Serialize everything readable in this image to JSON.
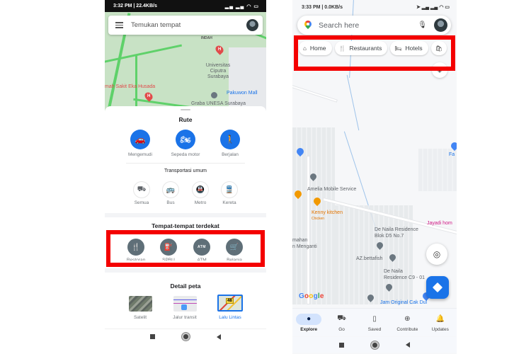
{
  "left_phone": {
    "status_bar": {
      "time": "3:32 PM | 22.4KB/s",
      "indicators": "signal · wifi · battery 30"
    },
    "search": {
      "placeholder": "Temukan tempat",
      "menu_icon": "hamburger-icon",
      "avatar": "profile-avatar"
    },
    "map_labels": {
      "indah": "INDAH",
      "universitas": "Universitas Ciputra Surabaya",
      "rs": "mah Sakit Eka Husada",
      "pakuwon": "Pakuwon Mall",
      "graha": "Graba UNESA Surabaya"
    },
    "route": {
      "title": "Rute",
      "modes": [
        {
          "label": "Mengemudi",
          "icon": "car-icon"
        },
        {
          "label": "Sepeda motor",
          "icon": "motorcycle-icon"
        },
        {
          "label": "Berjalan",
          "icon": "walk-icon"
        }
      ],
      "transit_title": "Transportasi umum",
      "transit_modes": [
        {
          "label": "Semua",
          "icon": "transit-icon"
        },
        {
          "label": "Bus",
          "icon": "bus-icon"
        },
        {
          "label": "Metro",
          "icon": "metro-icon"
        },
        {
          "label": "Kereta",
          "icon": "train-icon"
        }
      ]
    },
    "nearby": {
      "title": "Tempat-tempat terdekat",
      "items": [
        {
          "label": "Restoran",
          "icon": "restaurant-icon",
          "glyph": "🍴"
        },
        {
          "label": "SPBU",
          "icon": "gas-station-icon",
          "glyph": "⛽"
        },
        {
          "label": "ATM",
          "icon": "atm-icon",
          "glyph": "ATM"
        },
        {
          "label": "Belanja",
          "icon": "shopping-cart-icon",
          "glyph": "🛒"
        }
      ]
    },
    "map_details": {
      "title": "Detail peta",
      "layers": [
        {
          "label": "Satelit",
          "selected": false
        },
        {
          "label": "Jalur transit",
          "selected": false
        },
        {
          "label": "Lalu Lintas",
          "selected": true,
          "badge": "48"
        }
      ]
    }
  },
  "right_phone": {
    "status_bar": {
      "time": "3:33 PM | 0.0KB/s",
      "indicators": "location · signal · wifi · battery 30"
    },
    "search": {
      "placeholder": "Search here"
    },
    "chips": [
      {
        "label": "Home",
        "icon": "home-icon",
        "glyph": "⌂"
      },
      {
        "label": "Restaurants",
        "icon": "restaurant-icon",
        "glyph": "🍴"
      },
      {
        "label": "Hotels",
        "icon": "hotel-icon",
        "glyph": "🛏"
      },
      {
        "label": "",
        "icon": "shopping-bag-icon",
        "glyph": "🛍"
      }
    ],
    "map_labels": {
      "amelia": "Amelia Mobile Service",
      "kenny": "Kenny kitchen",
      "kenny_sub": "Chicken",
      "jayadi": "Jayadi hom",
      "denaila1": "De Naila Residence\nBlok D5 No.7",
      "rumahan": "mahan\nn Menganti",
      "azbetta": "AZ.bettafish",
      "denaila2": "De Naila\nResidence C9 - 01",
      "jam": "Jam Original Cak Dul",
      "fa": "Fa",
      "google": "Google"
    },
    "bottom_nav": [
      {
        "label": "Explore",
        "icon": "explore-pin-icon",
        "glyph": "📍",
        "active": true
      },
      {
        "label": "Go",
        "icon": "commute-icon",
        "glyph": "🚘",
        "active": false
      },
      {
        "label": "Saved",
        "icon": "bookmark-icon",
        "glyph": "🔖",
        "active": false
      },
      {
        "label": "Contribute",
        "icon": "add-circle-icon",
        "glyph": "⊕",
        "active": false
      },
      {
        "label": "Updates",
        "icon": "bell-icon",
        "glyph": "🔔",
        "active": false
      }
    ]
  },
  "highlight_color": "#f40000",
  "accent_color": "#1a73e8"
}
